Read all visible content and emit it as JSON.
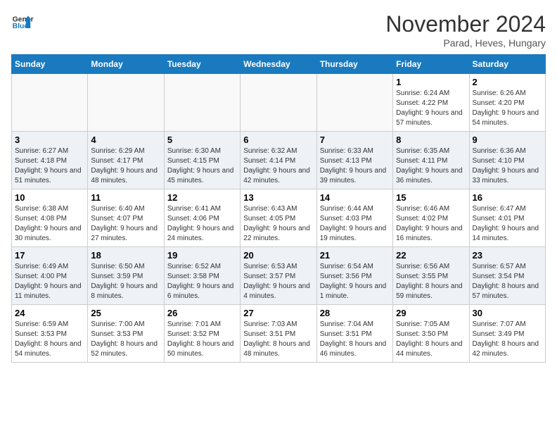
{
  "logo": {
    "line1": "General",
    "line2": "Blue"
  },
  "title": "November 2024",
  "subtitle": "Parad, Heves, Hungary",
  "days_of_week": [
    "Sunday",
    "Monday",
    "Tuesday",
    "Wednesday",
    "Thursday",
    "Friday",
    "Saturday"
  ],
  "weeks": [
    {
      "row_style": "even",
      "days": [
        {
          "num": "",
          "info": ""
        },
        {
          "num": "",
          "info": ""
        },
        {
          "num": "",
          "info": ""
        },
        {
          "num": "",
          "info": ""
        },
        {
          "num": "",
          "info": ""
        },
        {
          "num": "1",
          "info": "Sunrise: 6:24 AM\nSunset: 4:22 PM\nDaylight: 9 hours and 57 minutes."
        },
        {
          "num": "2",
          "info": "Sunrise: 6:26 AM\nSunset: 4:20 PM\nDaylight: 9 hours and 54 minutes."
        }
      ]
    },
    {
      "row_style": "odd",
      "days": [
        {
          "num": "3",
          "info": "Sunrise: 6:27 AM\nSunset: 4:18 PM\nDaylight: 9 hours and 51 minutes."
        },
        {
          "num": "4",
          "info": "Sunrise: 6:29 AM\nSunset: 4:17 PM\nDaylight: 9 hours and 48 minutes."
        },
        {
          "num": "5",
          "info": "Sunrise: 6:30 AM\nSunset: 4:15 PM\nDaylight: 9 hours and 45 minutes."
        },
        {
          "num": "6",
          "info": "Sunrise: 6:32 AM\nSunset: 4:14 PM\nDaylight: 9 hours and 42 minutes."
        },
        {
          "num": "7",
          "info": "Sunrise: 6:33 AM\nSunset: 4:13 PM\nDaylight: 9 hours and 39 minutes."
        },
        {
          "num": "8",
          "info": "Sunrise: 6:35 AM\nSunset: 4:11 PM\nDaylight: 9 hours and 36 minutes."
        },
        {
          "num": "9",
          "info": "Sunrise: 6:36 AM\nSunset: 4:10 PM\nDaylight: 9 hours and 33 minutes."
        }
      ]
    },
    {
      "row_style": "even",
      "days": [
        {
          "num": "10",
          "info": "Sunrise: 6:38 AM\nSunset: 4:08 PM\nDaylight: 9 hours and 30 minutes."
        },
        {
          "num": "11",
          "info": "Sunrise: 6:40 AM\nSunset: 4:07 PM\nDaylight: 9 hours and 27 minutes."
        },
        {
          "num": "12",
          "info": "Sunrise: 6:41 AM\nSunset: 4:06 PM\nDaylight: 9 hours and 24 minutes."
        },
        {
          "num": "13",
          "info": "Sunrise: 6:43 AM\nSunset: 4:05 PM\nDaylight: 9 hours and 22 minutes."
        },
        {
          "num": "14",
          "info": "Sunrise: 6:44 AM\nSunset: 4:03 PM\nDaylight: 9 hours and 19 minutes."
        },
        {
          "num": "15",
          "info": "Sunrise: 6:46 AM\nSunset: 4:02 PM\nDaylight: 9 hours and 16 minutes."
        },
        {
          "num": "16",
          "info": "Sunrise: 6:47 AM\nSunset: 4:01 PM\nDaylight: 9 hours and 14 minutes."
        }
      ]
    },
    {
      "row_style": "odd",
      "days": [
        {
          "num": "17",
          "info": "Sunrise: 6:49 AM\nSunset: 4:00 PM\nDaylight: 9 hours and 11 minutes."
        },
        {
          "num": "18",
          "info": "Sunrise: 6:50 AM\nSunset: 3:59 PM\nDaylight: 9 hours and 8 minutes."
        },
        {
          "num": "19",
          "info": "Sunrise: 6:52 AM\nSunset: 3:58 PM\nDaylight: 9 hours and 6 minutes."
        },
        {
          "num": "20",
          "info": "Sunrise: 6:53 AM\nSunset: 3:57 PM\nDaylight: 9 hours and 4 minutes."
        },
        {
          "num": "21",
          "info": "Sunrise: 6:54 AM\nSunset: 3:56 PM\nDaylight: 9 hours and 1 minute."
        },
        {
          "num": "22",
          "info": "Sunrise: 6:56 AM\nSunset: 3:55 PM\nDaylight: 8 hours and 59 minutes."
        },
        {
          "num": "23",
          "info": "Sunrise: 6:57 AM\nSunset: 3:54 PM\nDaylight: 8 hours and 57 minutes."
        }
      ]
    },
    {
      "row_style": "even",
      "days": [
        {
          "num": "24",
          "info": "Sunrise: 6:59 AM\nSunset: 3:53 PM\nDaylight: 8 hours and 54 minutes."
        },
        {
          "num": "25",
          "info": "Sunrise: 7:00 AM\nSunset: 3:53 PM\nDaylight: 8 hours and 52 minutes."
        },
        {
          "num": "26",
          "info": "Sunrise: 7:01 AM\nSunset: 3:52 PM\nDaylight: 8 hours and 50 minutes."
        },
        {
          "num": "27",
          "info": "Sunrise: 7:03 AM\nSunset: 3:51 PM\nDaylight: 8 hours and 48 minutes."
        },
        {
          "num": "28",
          "info": "Sunrise: 7:04 AM\nSunset: 3:51 PM\nDaylight: 8 hours and 46 minutes."
        },
        {
          "num": "29",
          "info": "Sunrise: 7:05 AM\nSunset: 3:50 PM\nDaylight: 8 hours and 44 minutes."
        },
        {
          "num": "30",
          "info": "Sunrise: 7:07 AM\nSunset: 3:49 PM\nDaylight: 8 hours and 42 minutes."
        }
      ]
    }
  ]
}
